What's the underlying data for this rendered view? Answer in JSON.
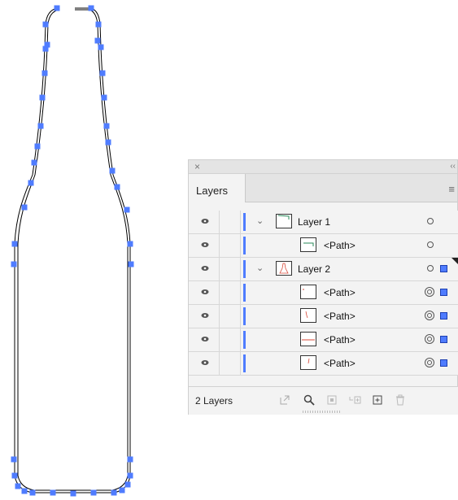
{
  "panel": {
    "tab_label": "Layers",
    "footer_label": "2 Layers",
    "accent_color": "#4f7cff",
    "rows": [
      {
        "label": "Layer 1",
        "type": "layer",
        "expanded": true,
        "target": "empty",
        "selected": false
      },
      {
        "label": "<Path>",
        "type": "path",
        "target": "empty",
        "selected": false
      },
      {
        "label": "Layer 2",
        "type": "layer",
        "expanded": true,
        "target": "empty",
        "selected": true
      },
      {
        "label": "<Path>",
        "type": "path",
        "target": "filled",
        "selected": true
      },
      {
        "label": "<Path>",
        "type": "path",
        "target": "filled",
        "selected": true
      },
      {
        "label": "<Path>",
        "type": "path",
        "target": "filled",
        "selected": true
      },
      {
        "label": "<Path>",
        "type": "path",
        "target": "filled",
        "selected": true
      }
    ],
    "footer_icons": [
      "export-icon",
      "search-icon",
      "clipping-mask-icon",
      "new-sublayer-icon",
      "new-layer-icon",
      "trash-icon"
    ]
  },
  "artwork": {
    "shape": "bottle-outline",
    "anchor_color": "#4f7cff"
  }
}
